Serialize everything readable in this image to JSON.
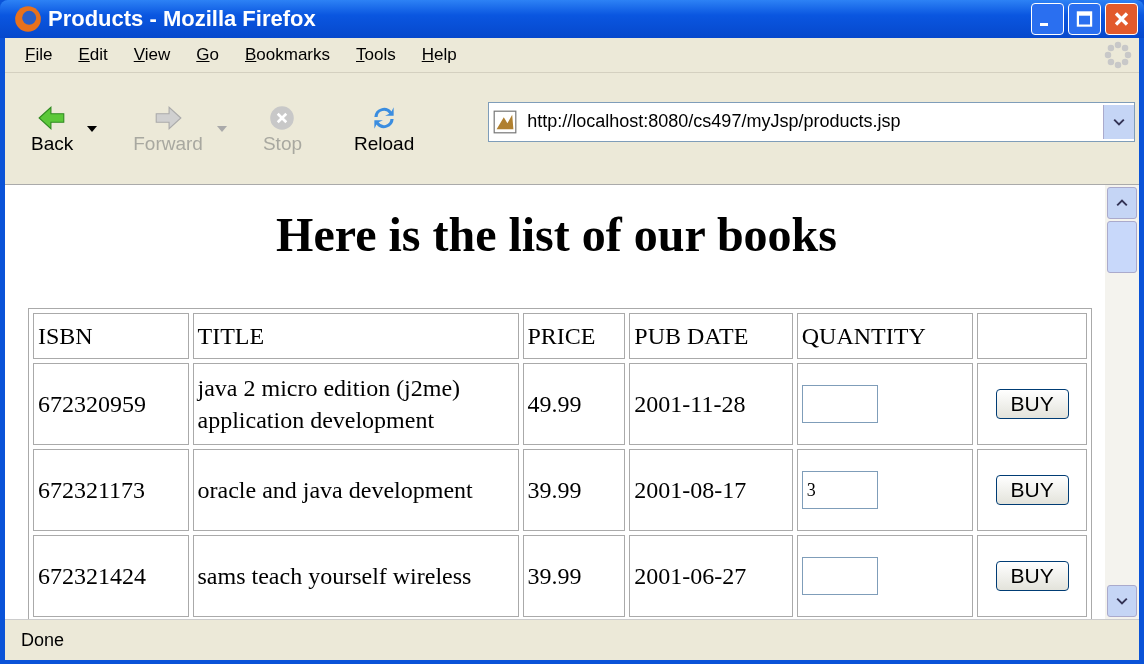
{
  "window": {
    "title": "Products - Mozilla Firefox"
  },
  "menu": [
    {
      "label": "File"
    },
    {
      "label": "Edit"
    },
    {
      "label": "View"
    },
    {
      "label": "Go"
    },
    {
      "label": "Bookmarks"
    },
    {
      "label": "Tools"
    },
    {
      "label": "Help"
    }
  ],
  "toolbar": [
    {
      "kind": "back",
      "label": "Back",
      "disabled": false,
      "dropdown": true
    },
    {
      "kind": "forward",
      "label": "Forward",
      "disabled": true,
      "dropdown": true
    },
    {
      "kind": "stop",
      "label": "Stop",
      "disabled": true,
      "dropdown": false
    },
    {
      "kind": "reload",
      "label": "Reload",
      "disabled": false,
      "dropdown": false
    }
  ],
  "address": {
    "value": "http://localhost:8080/cs497/myJsp/products.jsp"
  },
  "page": {
    "heading": "Here is the list of our books",
    "columns": [
      "ISBN",
      "TITLE",
      "PRICE",
      "PUB DATE",
      "QUANTITY"
    ],
    "rows": [
      {
        "isbn": "672320959",
        "title": "java 2 micro edition (j2me) application development",
        "price": "49.99",
        "date": "2001-11-28",
        "button": "BUY"
      },
      {
        "isbn": "672321173",
        "title": "oracle and java development",
        "price": "39.99",
        "date": "2001-08-17",
        "quantity": "3",
        "button": "BUY"
      },
      {
        "isbn": "672321424",
        "title": "sams teach yourself wireless",
        "price": "39.99",
        "date": "2001-06-27",
        "button": "BUY"
      }
    ]
  },
  "status_bar": {
    "text": "Done"
  }
}
